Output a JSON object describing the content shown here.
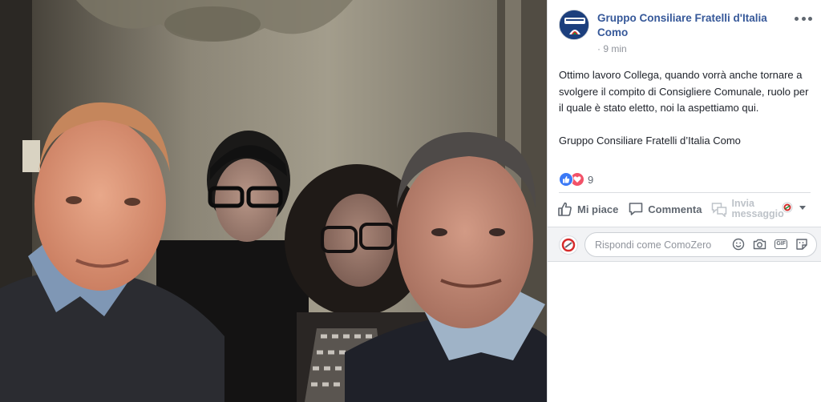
{
  "post": {
    "page_name": "Gruppo Consiliare Fratelli d'Italia Como",
    "timestamp": "· 9 min",
    "paragraph_1": "Ottimo lavoro Collega, quando vorrà anche tornare a svolgere il compito di Consigliere Comunale, ruolo per il quale è stato eletto, noi la aspettiamo qui.",
    "paragraph_2": "Gruppo Consiliare Fratelli d’Italia Como"
  },
  "reactions": {
    "count": "9",
    "types": [
      "like-icon",
      "love-icon"
    ]
  },
  "actions": {
    "like_label": "Mi piace",
    "comment_label": "Commenta",
    "message_label_line1": "Invia",
    "message_label_line2": "messaggio"
  },
  "comment": {
    "placeholder": "Rispondi come ComoZero",
    "gif_label": "GIF"
  },
  "colors": {
    "link_blue": "#365899",
    "like_blue": "#3b79f6",
    "love_red": "#f25268",
    "text_gray": "#606770"
  },
  "photo": {
    "description_icon": "selfie-photo"
  }
}
